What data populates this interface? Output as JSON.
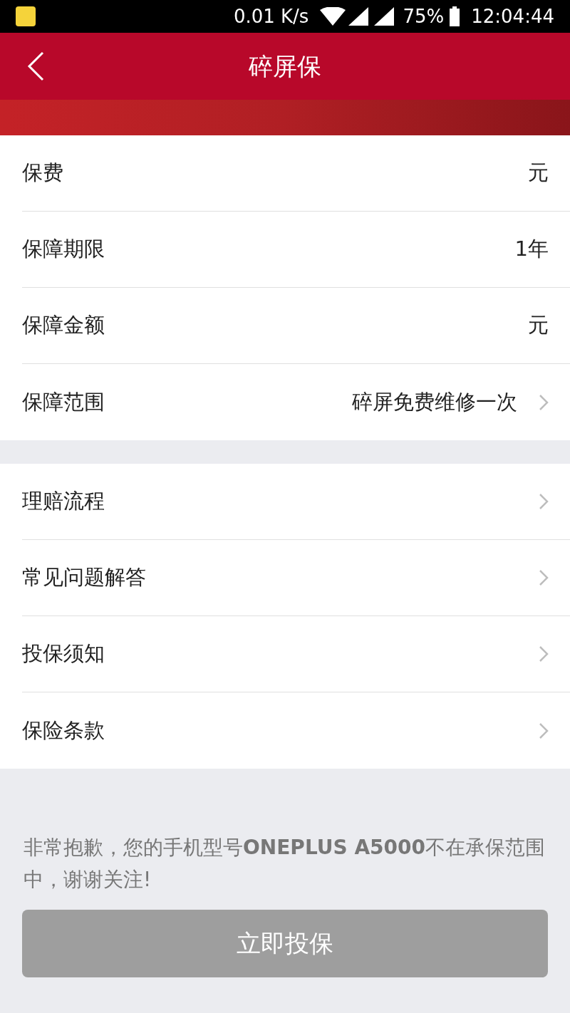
{
  "status_bar": {
    "net_speed": "0.01 K/s",
    "battery": "75%",
    "time": "12:04:44"
  },
  "header": {
    "title": "碎屏保"
  },
  "groups": [
    {
      "rows": [
        {
          "label": "保费",
          "value": "元",
          "chevron": false
        },
        {
          "label": "保障期限",
          "value": "1年",
          "chevron": false
        },
        {
          "label": "保障金额",
          "value": "元",
          "chevron": false
        },
        {
          "label": "保障范围",
          "value": "碎屏免费维修一次",
          "chevron": true
        }
      ]
    },
    {
      "rows": [
        {
          "label": "理赔流程",
          "chevron": true
        },
        {
          "label": "常见问题解答",
          "chevron": true
        },
        {
          "label": "投保须知",
          "chevron": true
        },
        {
          "label": "保险条款",
          "chevron": true
        }
      ]
    }
  ],
  "notice": "非常抱歉，您的手机型号**ONEPLUS A5000**不在承保范围中，谢谢关注!",
  "submit": {
    "label": "立即投保",
    "disabled": true
  }
}
